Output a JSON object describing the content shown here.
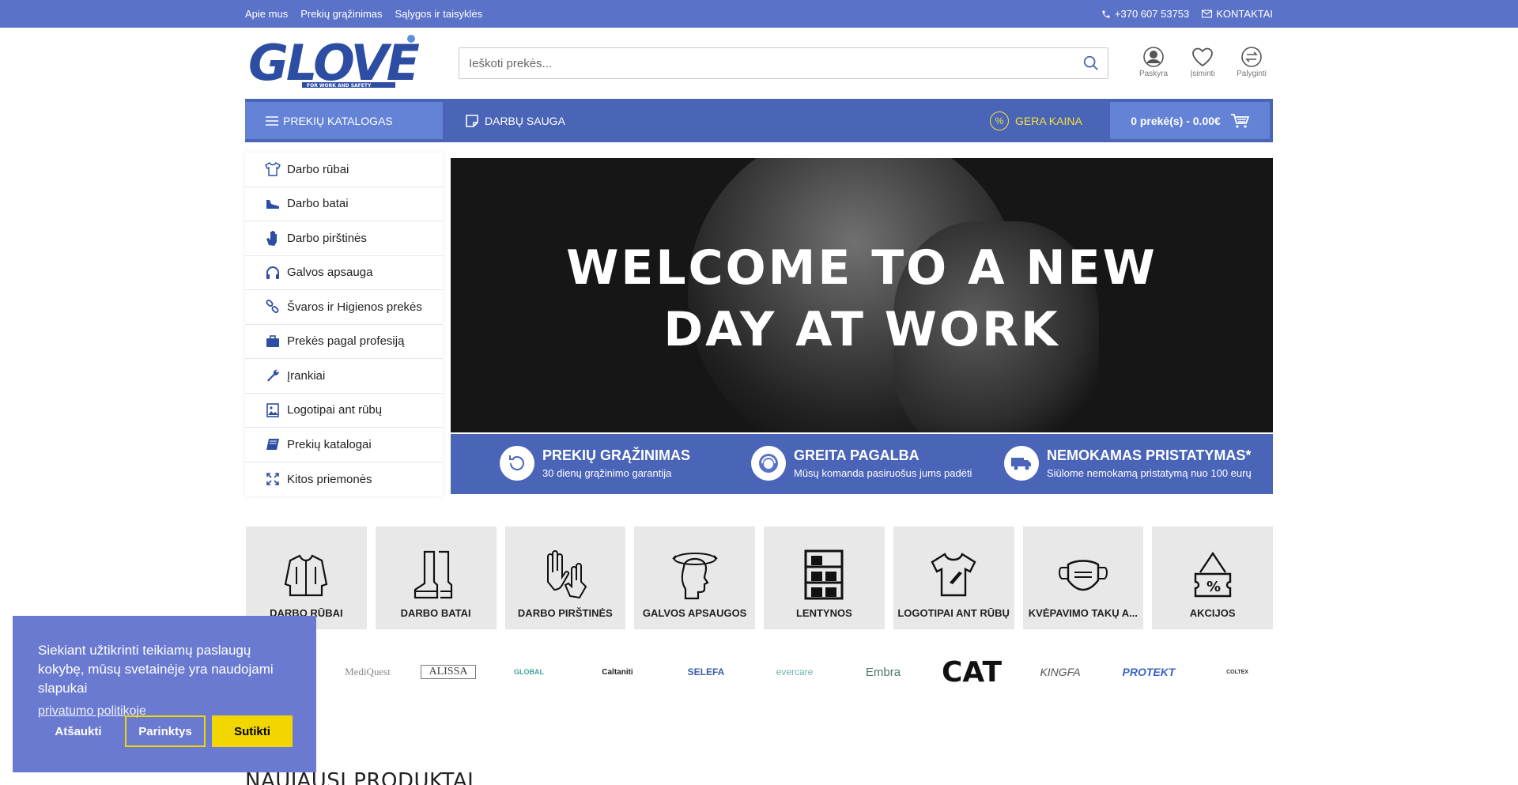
{
  "topbar": {
    "links": [
      "Apie mus",
      "Prekių grąžinimas",
      "Sąlygos ir taisyklės"
    ],
    "phone": "+370 607 53753",
    "contacts": "KONTAKTAI"
  },
  "header": {
    "logo_text": "GLOVE",
    "logo_tagline": "FOR WORK AND SAFETY",
    "search_placeholder": "Ieškoti prekės...",
    "icons": [
      {
        "label": "Paskyra",
        "icon": "user-icon"
      },
      {
        "label": "Įsiminti",
        "icon": "heart-icon"
      },
      {
        "label": "Palyginti",
        "icon": "compare-icon"
      }
    ]
  },
  "nav": {
    "catalog": "PREKIŲ KATALOGAS",
    "safety": "DARBŲ SAUGA",
    "price": "GERA KAINA",
    "cart": "0 prekė(s) - 0.00€"
  },
  "sidemenu": [
    {
      "label": "Darbo rūbai",
      "icon": "shirt-icon"
    },
    {
      "label": "Darbo batai",
      "icon": "shoe-icon"
    },
    {
      "label": "Darbo pirštinės",
      "icon": "glove-icon"
    },
    {
      "label": "Galvos apsauga",
      "icon": "headphones-icon"
    },
    {
      "label": "Švaros ir Higienos prekės",
      "icon": "link-icon"
    },
    {
      "label": "Prekės pagal profesiją",
      "icon": "briefcase-icon"
    },
    {
      "label": "Įrankiai",
      "icon": "wrench-icon"
    },
    {
      "label": "Logotipai ant rūbų",
      "icon": "image-icon"
    },
    {
      "label": "Prekių katalogai",
      "icon": "book-icon"
    },
    {
      "label": "Kitos priemonės",
      "icon": "expand-icon"
    }
  ],
  "hero": {
    "line1": "WELCOME TO A NEW",
    "line2": "DAY AT WORK"
  },
  "benefits": [
    {
      "title": "PREKIŲ GRĄŽINIMAS",
      "subtitle": "30 dienų grąžinimo garantija",
      "icon": "return-icon"
    },
    {
      "title": "GREITA PAGALBA",
      "subtitle": "Mūsų komanda pasiruošus jums padėti",
      "icon": "support-icon"
    },
    {
      "title": "NEMOKAMAS PRISTATYMAS*",
      "subtitle": "Siūlome nemokamą pristatymą nuo 100 eurų",
      "icon": "truck-icon"
    }
  ],
  "tiles": [
    {
      "label": "DARBO RŪBAI",
      "icon": "jacket-icon"
    },
    {
      "label": "DARBO BATAI",
      "icon": "boots-icon"
    },
    {
      "label": "DARBO PIRŠTINĖS",
      "icon": "gloves-icon"
    },
    {
      "label": "GALVOS APSAUGOS",
      "icon": "head-icon"
    },
    {
      "label": "LENTYNOS",
      "icon": "shelves-icon"
    },
    {
      "label": "LOGOTIPAI ANT RŪBŲ",
      "icon": "tshirt-icon"
    },
    {
      "label": "KVĖPAVIMO TAKŲ A...",
      "icon": "mask-icon"
    },
    {
      "label": "AKCIJOS",
      "icon": "discount-icon"
    }
  ],
  "brands": [
    "MediQuest",
    "ALISSA",
    "GLOBAL",
    "Caltaniti",
    "SELEFA",
    "evercare",
    "Embra",
    "CAT",
    "KINGFA",
    "PROTEKT",
    "COLTEX"
  ],
  "newest_heading": "NAUJAUSI PRODUKTAI",
  "cookie": {
    "message": "Siekiant užtikrinti teikiamų paslaugų kokybę, mūsų svetainėje yra naudojami slapukai",
    "link": "privatumo politikoje",
    "decline": "Atšaukti",
    "options": "Parinktys",
    "accept": "Sutikti"
  },
  "colors": {
    "topbar": "#5a73c8",
    "nav": "#4a64b8",
    "nav_active": "#6482d6",
    "accent_yellow": "#f3e23a",
    "cookie_bg": "#6b7ad1",
    "cookie_accent": "#f1d600"
  }
}
